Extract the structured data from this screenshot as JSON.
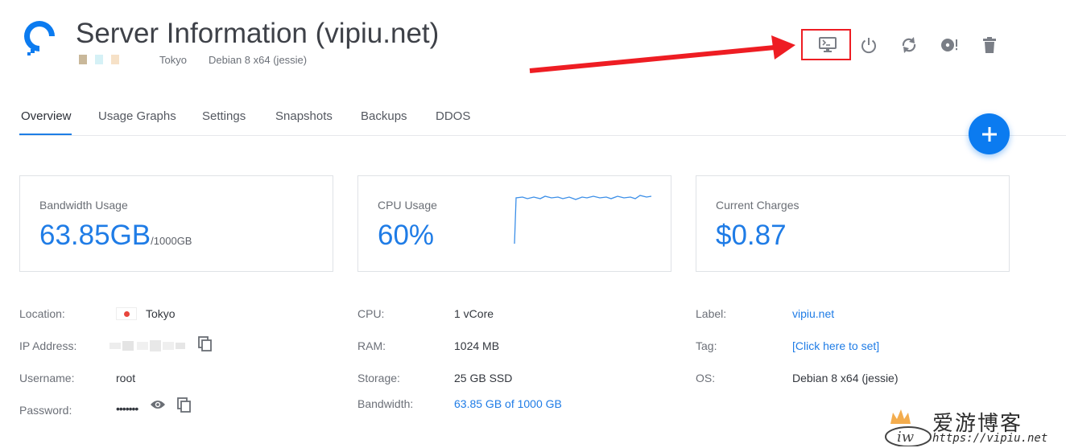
{
  "header": {
    "title": "Server Information (vipiu.net)",
    "location": "Tokyo",
    "os": "Debian 8 x64 (jessie)",
    "blurred_squares": [
      "#c9b89a",
      "#d5f1f6",
      "#f6e1c7"
    ]
  },
  "toolbar": {
    "console_icon": "monitor-console-icon",
    "power_icon": "power-icon",
    "restart_icon": "refresh-icon",
    "iso_icon": "disc-icon",
    "delete_icon": "trash-icon",
    "highlight_color": "#ee1d23"
  },
  "tabs": [
    {
      "label": "Overview",
      "active": true
    },
    {
      "label": "Usage Graphs",
      "active": false
    },
    {
      "label": "Settings",
      "active": false
    },
    {
      "label": "Snapshots",
      "active": false
    },
    {
      "label": "Backups",
      "active": false
    },
    {
      "label": "DDOS",
      "active": false
    }
  ],
  "fab": {
    "icon": "plus-icon"
  },
  "cards": {
    "bandwidth": {
      "label": "Bandwidth Usage",
      "value": "63.85GB",
      "suffix": "/1000GB"
    },
    "cpu": {
      "label": "CPU Usage",
      "value": "60%"
    },
    "charges": {
      "label": "Current Charges",
      "value": "$0.87"
    }
  },
  "details": {
    "location_label": "Location:",
    "location_value": "Tokyo",
    "ip_label": "IP Address:",
    "username_label": "Username:",
    "username_value": "root",
    "password_label": "Password:",
    "password_value": "•••••••",
    "cpu_label": "CPU:",
    "cpu_value": "1 vCore",
    "ram_label": "RAM:",
    "ram_value": "1024 MB",
    "storage_label": "Storage:",
    "storage_value": "25 GB SSD",
    "bandwidth_label": "Bandwidth:",
    "bandwidth_value": "63.85 GB of 1000 GB",
    "label_label": "Label:",
    "label_value": "vipiu.net",
    "tag_label": "Tag:",
    "tag_value": "[Click here to set]",
    "os_label": "OS:",
    "os_value": "Debian 8 x64 (jessie)"
  },
  "watermark": {
    "chinese": "爱游博客",
    "url": "https://vipiu.net"
  },
  "colors": {
    "accent": "#1f7ce6",
    "fab": "#0b7bf0",
    "arrow": "#ee1d23"
  }
}
